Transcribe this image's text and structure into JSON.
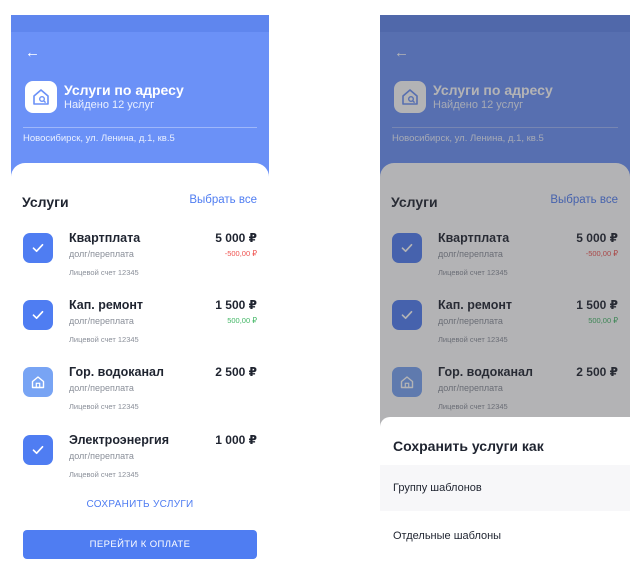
{
  "header": {
    "title": "Услуги по адресу",
    "subtitle": "Найдено 12 услуг",
    "address": "Новосибирск, ул. Ленина, д.1, кв.5"
  },
  "services": {
    "title": "Услуги",
    "select_all": "Выбрать все",
    "items": [
      {
        "name": "Квартплата",
        "amount": "5 000 ₽",
        "debt_label": "долг/переплата",
        "delta": "-500,00 ₽",
        "delta_sign": "negative",
        "account": "Лицевой счет 12345",
        "checked": true
      },
      {
        "name": "Кап. ремонт",
        "amount": "1 500 ₽",
        "debt_label": "долг/переплата",
        "delta": "500,00 ₽",
        "delta_sign": "positive",
        "account": "Лицевой счет 12345",
        "checked": true
      },
      {
        "name": "Гор. водоканал",
        "amount": "2 500 ₽",
        "debt_label": "долг/переплата",
        "delta": "",
        "delta_sign": "none",
        "account": "Лицевой счет 12345",
        "checked": false
      },
      {
        "name": "Электроэнергия",
        "amount": "1 000 ₽",
        "debt_label": "долг/переплата",
        "delta": "",
        "delta_sign": "none",
        "account": "Лицевой счет 12345",
        "checked": true
      }
    ]
  },
  "actions": {
    "save_services": "СОХРАНИТЬ УСЛУГИ",
    "go_to_payment": "ПЕРЕЙТИ К ОПЛАТЕ"
  },
  "save_dialog": {
    "title": "Сохранить услуги как",
    "options": [
      "Группу шаблонов",
      "Отдельные шаблоны"
    ]
  },
  "icons": {
    "back": "arrow-left-icon",
    "address": "house-search-icon",
    "checked": "checkmark-icon",
    "service": "house-icon"
  },
  "colors": {
    "accent": "#4f7df2",
    "header": "#6b91f7",
    "negative": "#ef5350",
    "positive": "#43b766"
  }
}
